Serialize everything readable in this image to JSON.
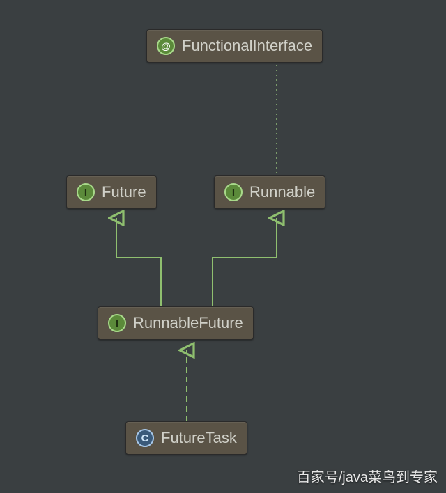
{
  "nodes": {
    "functionalInterface": {
      "label": "FunctionalInterface",
      "kind": "annotation",
      "badge": "@"
    },
    "future": {
      "label": "Future",
      "kind": "interface",
      "badge": "I"
    },
    "runnable": {
      "label": "Runnable",
      "kind": "interface",
      "badge": "I"
    },
    "runnableFuture": {
      "label": "RunnableFuture",
      "kind": "interface",
      "badge": "I"
    },
    "futureTask": {
      "label": "FutureTask",
      "kind": "class",
      "badge": "C"
    }
  },
  "edges": [
    {
      "from": "runnable",
      "to": "functionalInterface",
      "style": "dotted",
      "arrow": false
    },
    {
      "from": "runnableFuture",
      "to": "future",
      "style": "solid",
      "arrow": true
    },
    {
      "from": "runnableFuture",
      "to": "runnable",
      "style": "solid",
      "arrow": true
    },
    {
      "from": "futureTask",
      "to": "runnableFuture",
      "style": "dashed",
      "arrow": true
    }
  ],
  "watermark": "百家号/java菜鸟到专家",
  "colors": {
    "background": "#3a3f41",
    "nodeFill": "#5a5346",
    "connector": "#8fbf6f",
    "connectorDotted": "#7a9a6a"
  }
}
